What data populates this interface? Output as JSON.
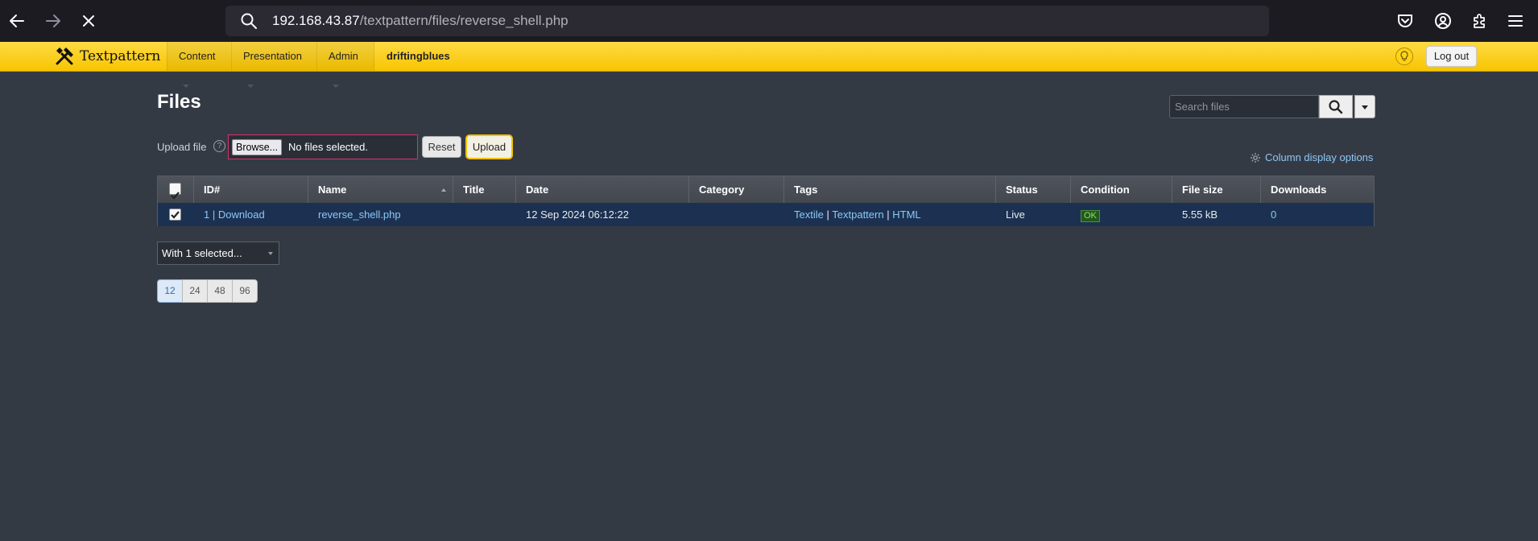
{
  "browser": {
    "url_host": "192.168.43.87",
    "url_path": "/textpattern/files/reverse_shell.php"
  },
  "header": {
    "brand": "Textpattern",
    "menu": {
      "content": "Content",
      "presentation": "Presentation",
      "admin": "Admin"
    },
    "site_name": "driftingblues",
    "logout": "Log out"
  },
  "main": {
    "title": "Files",
    "search_placeholder": "Search files",
    "upload_label": "Upload file",
    "browse_label": "Browse...",
    "no_files": "No files selected.",
    "reset": "Reset",
    "upload": "Upload",
    "column_options": "Column display options"
  },
  "table": {
    "columns": [
      "ID#",
      "Name",
      "Title",
      "Date",
      "Category",
      "Tags",
      "Status",
      "Condition",
      "File size",
      "Downloads"
    ],
    "rows": [
      {
        "id": "1",
        "id_sep": "|",
        "download": "Download",
        "name": "reverse_shell.php",
        "title": "",
        "date": "12 Sep 2024 06:12:22",
        "category": "",
        "tags": [
          "Textile",
          "Textpattern",
          "HTML"
        ],
        "tag_sep": "|",
        "status": "Live",
        "condition": "OK",
        "file_size": "5.55 kB",
        "downloads": "0",
        "selected": true
      }
    ]
  },
  "bulk": {
    "label": "With 1 selected..."
  },
  "pagination": {
    "options": [
      "12",
      "24",
      "48",
      "96"
    ],
    "active": "12"
  },
  "colors": {
    "header_yellow": "#ffda44",
    "page_bg": "#343a44",
    "row_selected": "#1c3151",
    "link": "#8cc8f6"
  }
}
